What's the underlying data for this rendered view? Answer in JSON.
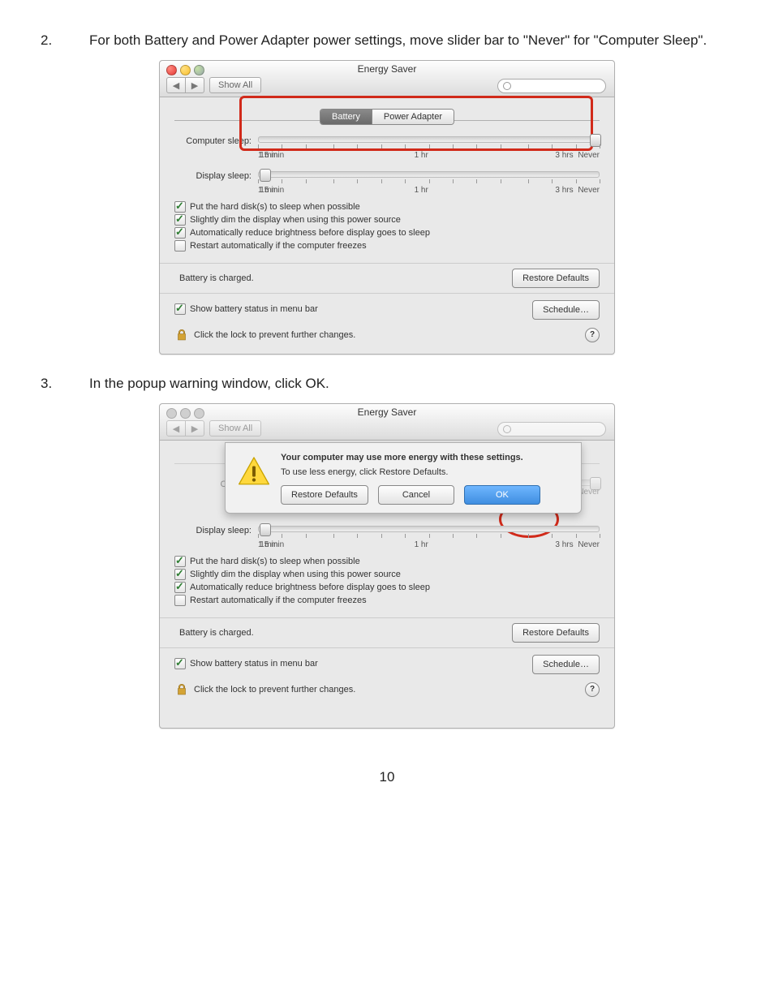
{
  "steps": {
    "s2": {
      "num": "2.",
      "text": "For both Battery and Power Adapter power settings, move slider bar to \"Never\" for \"Computer Sleep\"."
    },
    "s3": {
      "num": "3.",
      "text": "In the popup warning window, click OK."
    }
  },
  "window": {
    "title": "Energy Saver",
    "show_all": "Show All",
    "tabs": {
      "battery": "Battery",
      "adapter": "Power Adapter"
    },
    "sliders": {
      "computer": {
        "label": "Computer sleep:",
        "marks": {
          "m1": "1 min",
          "m15": "15 min",
          "m1h": "1 hr",
          "m3h": "3 hrs",
          "never": "Never"
        }
      },
      "display": {
        "label": "Display sleep:",
        "marks": {
          "m1": "1 min",
          "m15": "15 min",
          "m1h": "1 hr",
          "m3h": "3 hrs",
          "never": "Never"
        }
      }
    },
    "checks": {
      "hd": "Put the hard disk(s) to sleep when possible",
      "dim": "Slightly dim the display when using this power source",
      "bright": "Automatically reduce brightness before display goes to sleep",
      "restart": "Restart automatically if the computer freezes"
    },
    "status": "Battery is charged.",
    "restore_defaults": "Restore Defaults",
    "show_menu_bar": "Show battery status in menu bar",
    "schedule": "Schedule…",
    "lock_text": "Click the lock to prevent further changes.",
    "help": "?"
  },
  "dialog": {
    "heading": "Your computer may use more energy with these settings.",
    "body": "To use less energy, click Restore Defaults.",
    "restore": "Restore Defaults",
    "cancel": "Cancel",
    "ok": "OK"
  },
  "page_number": "10"
}
